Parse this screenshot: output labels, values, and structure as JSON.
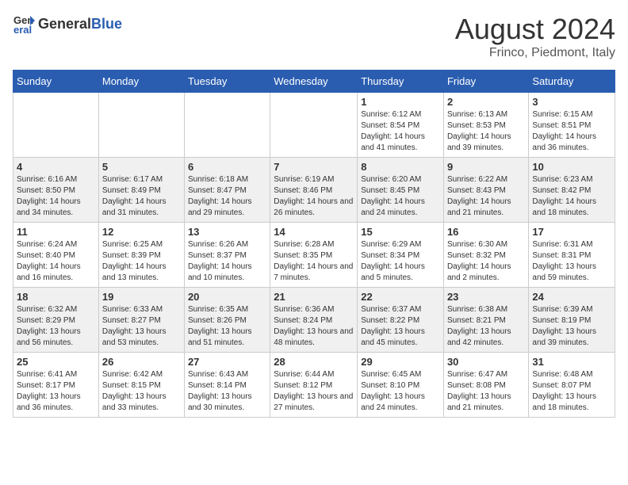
{
  "header": {
    "logo_general": "General",
    "logo_blue": "Blue",
    "month_title": "August 2024",
    "location": "Frinco, Piedmont, Italy"
  },
  "calendar": {
    "days_of_week": [
      "Sunday",
      "Monday",
      "Tuesday",
      "Wednesday",
      "Thursday",
      "Friday",
      "Saturday"
    ],
    "weeks": [
      [
        {
          "day": "",
          "sunrise": "",
          "sunset": "",
          "daylight": ""
        },
        {
          "day": "",
          "sunrise": "",
          "sunset": "",
          "daylight": ""
        },
        {
          "day": "",
          "sunrise": "",
          "sunset": "",
          "daylight": ""
        },
        {
          "day": "",
          "sunrise": "",
          "sunset": "",
          "daylight": ""
        },
        {
          "day": "1",
          "sunrise": "Sunrise: 6:12 AM",
          "sunset": "Sunset: 8:54 PM",
          "daylight": "Daylight: 14 hours and 41 minutes."
        },
        {
          "day": "2",
          "sunrise": "Sunrise: 6:13 AM",
          "sunset": "Sunset: 8:53 PM",
          "daylight": "Daylight: 14 hours and 39 minutes."
        },
        {
          "day": "3",
          "sunrise": "Sunrise: 6:15 AM",
          "sunset": "Sunset: 8:51 PM",
          "daylight": "Daylight: 14 hours and 36 minutes."
        }
      ],
      [
        {
          "day": "4",
          "sunrise": "Sunrise: 6:16 AM",
          "sunset": "Sunset: 8:50 PM",
          "daylight": "Daylight: 14 hours and 34 minutes."
        },
        {
          "day": "5",
          "sunrise": "Sunrise: 6:17 AM",
          "sunset": "Sunset: 8:49 PM",
          "daylight": "Daylight: 14 hours and 31 minutes."
        },
        {
          "day": "6",
          "sunrise": "Sunrise: 6:18 AM",
          "sunset": "Sunset: 8:47 PM",
          "daylight": "Daylight: 14 hours and 29 minutes."
        },
        {
          "day": "7",
          "sunrise": "Sunrise: 6:19 AM",
          "sunset": "Sunset: 8:46 PM",
          "daylight": "Daylight: 14 hours and 26 minutes."
        },
        {
          "day": "8",
          "sunrise": "Sunrise: 6:20 AM",
          "sunset": "Sunset: 8:45 PM",
          "daylight": "Daylight: 14 hours and 24 minutes."
        },
        {
          "day": "9",
          "sunrise": "Sunrise: 6:22 AM",
          "sunset": "Sunset: 8:43 PM",
          "daylight": "Daylight: 14 hours and 21 minutes."
        },
        {
          "day": "10",
          "sunrise": "Sunrise: 6:23 AM",
          "sunset": "Sunset: 8:42 PM",
          "daylight": "Daylight: 14 hours and 18 minutes."
        }
      ],
      [
        {
          "day": "11",
          "sunrise": "Sunrise: 6:24 AM",
          "sunset": "Sunset: 8:40 PM",
          "daylight": "Daylight: 14 hours and 16 minutes."
        },
        {
          "day": "12",
          "sunrise": "Sunrise: 6:25 AM",
          "sunset": "Sunset: 8:39 PM",
          "daylight": "Daylight: 14 hours and 13 minutes."
        },
        {
          "day": "13",
          "sunrise": "Sunrise: 6:26 AM",
          "sunset": "Sunset: 8:37 PM",
          "daylight": "Daylight: 14 hours and 10 minutes."
        },
        {
          "day": "14",
          "sunrise": "Sunrise: 6:28 AM",
          "sunset": "Sunset: 8:35 PM",
          "daylight": "Daylight: 14 hours and 7 minutes."
        },
        {
          "day": "15",
          "sunrise": "Sunrise: 6:29 AM",
          "sunset": "Sunset: 8:34 PM",
          "daylight": "Daylight: 14 hours and 5 minutes."
        },
        {
          "day": "16",
          "sunrise": "Sunrise: 6:30 AM",
          "sunset": "Sunset: 8:32 PM",
          "daylight": "Daylight: 14 hours and 2 minutes."
        },
        {
          "day": "17",
          "sunrise": "Sunrise: 6:31 AM",
          "sunset": "Sunset: 8:31 PM",
          "daylight": "Daylight: 13 hours and 59 minutes."
        }
      ],
      [
        {
          "day": "18",
          "sunrise": "Sunrise: 6:32 AM",
          "sunset": "Sunset: 8:29 PM",
          "daylight": "Daylight: 13 hours and 56 minutes."
        },
        {
          "day": "19",
          "sunrise": "Sunrise: 6:33 AM",
          "sunset": "Sunset: 8:27 PM",
          "daylight": "Daylight: 13 hours and 53 minutes."
        },
        {
          "day": "20",
          "sunrise": "Sunrise: 6:35 AM",
          "sunset": "Sunset: 8:26 PM",
          "daylight": "Daylight: 13 hours and 51 minutes."
        },
        {
          "day": "21",
          "sunrise": "Sunrise: 6:36 AM",
          "sunset": "Sunset: 8:24 PM",
          "daylight": "Daylight: 13 hours and 48 minutes."
        },
        {
          "day": "22",
          "sunrise": "Sunrise: 6:37 AM",
          "sunset": "Sunset: 8:22 PM",
          "daylight": "Daylight: 13 hours and 45 minutes."
        },
        {
          "day": "23",
          "sunrise": "Sunrise: 6:38 AM",
          "sunset": "Sunset: 8:21 PM",
          "daylight": "Daylight: 13 hours and 42 minutes."
        },
        {
          "day": "24",
          "sunrise": "Sunrise: 6:39 AM",
          "sunset": "Sunset: 8:19 PM",
          "daylight": "Daylight: 13 hours and 39 minutes."
        }
      ],
      [
        {
          "day": "25",
          "sunrise": "Sunrise: 6:41 AM",
          "sunset": "Sunset: 8:17 PM",
          "daylight": "Daylight: 13 hours and 36 minutes."
        },
        {
          "day": "26",
          "sunrise": "Sunrise: 6:42 AM",
          "sunset": "Sunset: 8:15 PM",
          "daylight": "Daylight: 13 hours and 33 minutes."
        },
        {
          "day": "27",
          "sunrise": "Sunrise: 6:43 AM",
          "sunset": "Sunset: 8:14 PM",
          "daylight": "Daylight: 13 hours and 30 minutes."
        },
        {
          "day": "28",
          "sunrise": "Sunrise: 6:44 AM",
          "sunset": "Sunset: 8:12 PM",
          "daylight": "Daylight: 13 hours and 27 minutes."
        },
        {
          "day": "29",
          "sunrise": "Sunrise: 6:45 AM",
          "sunset": "Sunset: 8:10 PM",
          "daylight": "Daylight: 13 hours and 24 minutes."
        },
        {
          "day": "30",
          "sunrise": "Sunrise: 6:47 AM",
          "sunset": "Sunset: 8:08 PM",
          "daylight": "Daylight: 13 hours and 21 minutes."
        },
        {
          "day": "31",
          "sunrise": "Sunrise: 6:48 AM",
          "sunset": "Sunset: 8:07 PM",
          "daylight": "Daylight: 13 hours and 18 minutes."
        }
      ]
    ]
  }
}
